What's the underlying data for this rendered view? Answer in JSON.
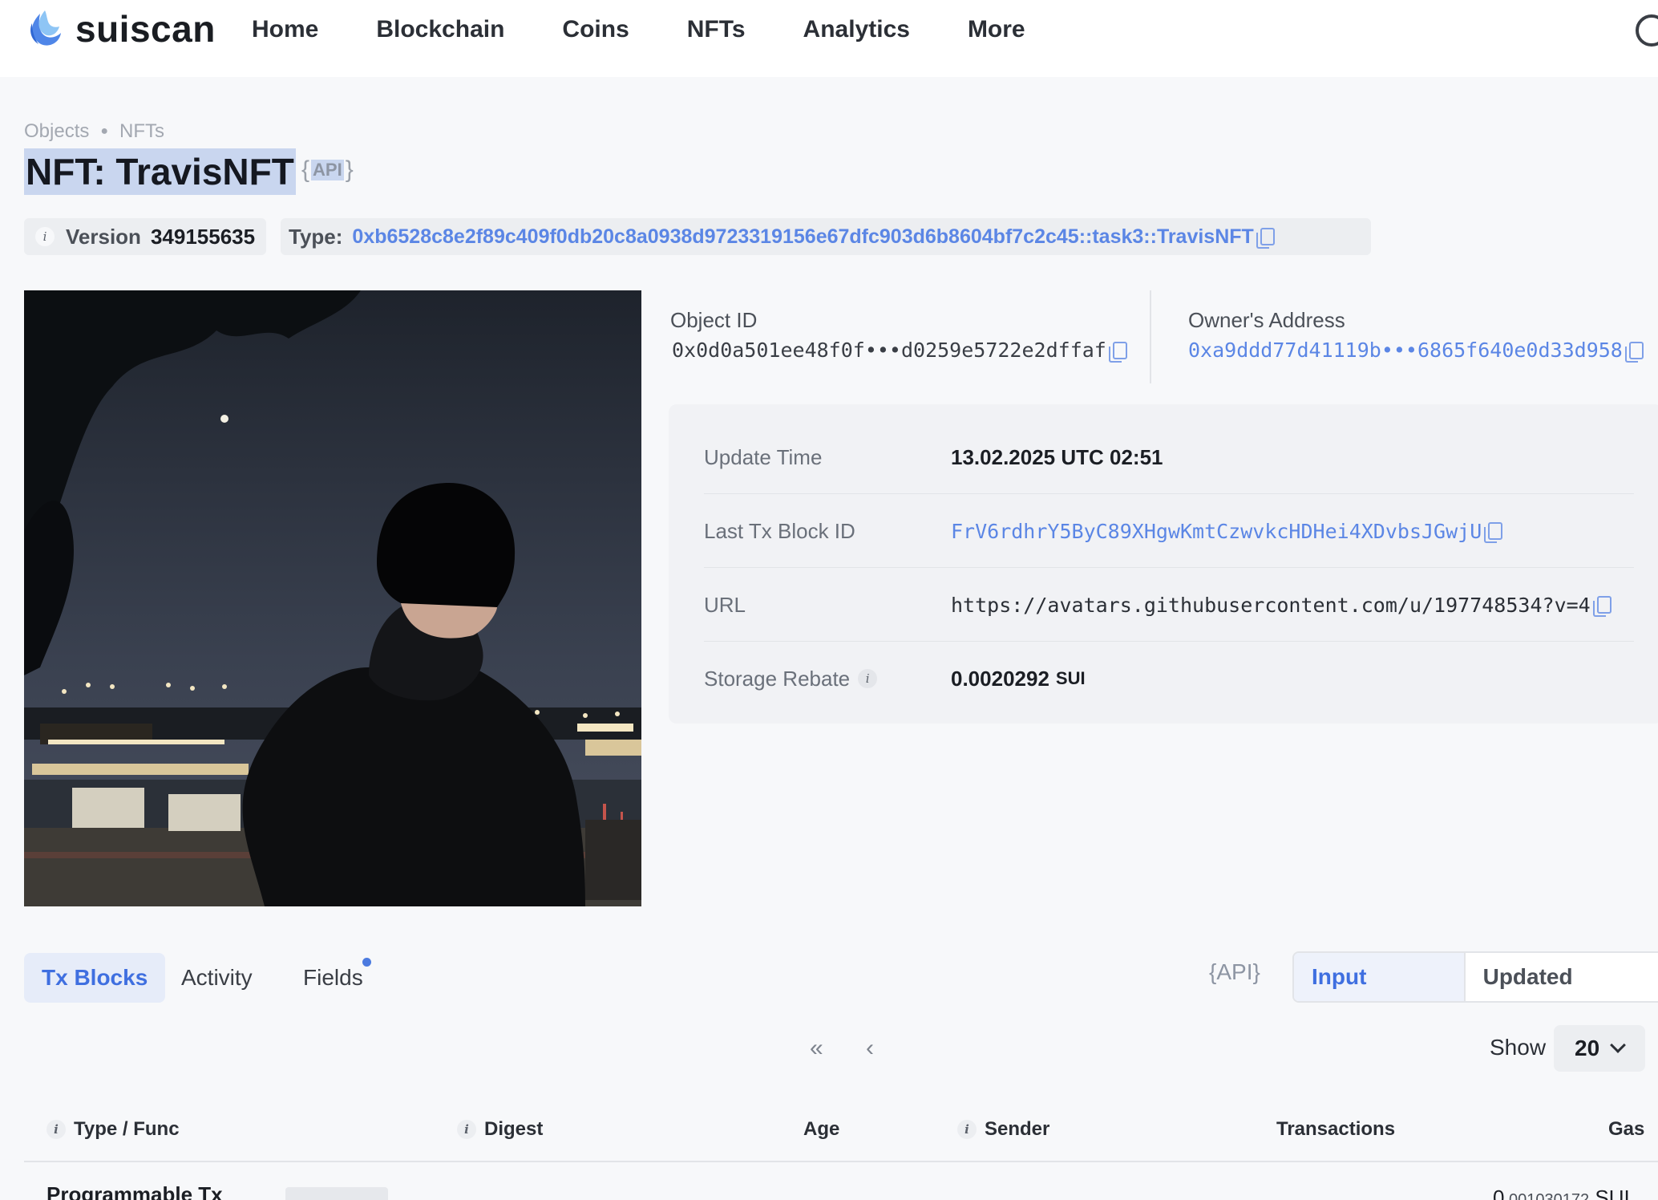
{
  "brand": {
    "name": "suiscan",
    "accent": "#5b86e5"
  },
  "nav": [
    "Home",
    "Blockchain",
    "Coins",
    "NFTs",
    "Analytics",
    "More"
  ],
  "breadcrumb": [
    "Objects",
    "NFTs"
  ],
  "page": {
    "title": "NFT: TravisNFT",
    "api_label": "API"
  },
  "version": {
    "label": "Version",
    "value": "349155635"
  },
  "type": {
    "label": "Type:",
    "value": "0xb6528c8e2f89c409f0db20c8a0938d9723319156e67dfc903d6b8604bf7c2c45::task3::TravisNFT"
  },
  "object": {
    "id_label": "Object ID",
    "id_value": "0x0d0a501ee48f0f•••d0259e5722e2dffaf",
    "owner_label": "Owner's Address",
    "owner_value": "0xa9ddd77d41119b•••6865f640e0d33d958"
  },
  "details": {
    "update_time_label": "Update Time",
    "update_time_value": "13.02.2025 UTC 02:51",
    "last_tx_label": "Last Tx Block ID",
    "last_tx_value": "FrV6rdhrY5ByC89XHgwKmtCzwvkcHDHei4XDvbsJGwjU",
    "url_label": "URL",
    "url_value": "https://avatars.githubusercontent.com/u/197748534?v=4",
    "rebate_label": "Storage Rebate",
    "rebate_value": "0.0020292",
    "rebate_unit": "SUI"
  },
  "tabs": [
    "Tx Blocks",
    "Activity",
    "Fields"
  ],
  "api_link": "{API}",
  "segments": [
    "Input Objects",
    "Updated Objects"
  ],
  "pager": {
    "first": "«",
    "prev": "‹",
    "show_label": "Show",
    "show_value": "20"
  },
  "table": {
    "columns": [
      "Type / Func",
      "Digest",
      "Age",
      "Sender",
      "Transactions",
      "Gas"
    ],
    "rows": [
      {
        "type": "Programmable Tx",
        "gas_int": "0",
        "gas_frac": ".001030172",
        "gas_unit": "SUI"
      }
    ]
  }
}
